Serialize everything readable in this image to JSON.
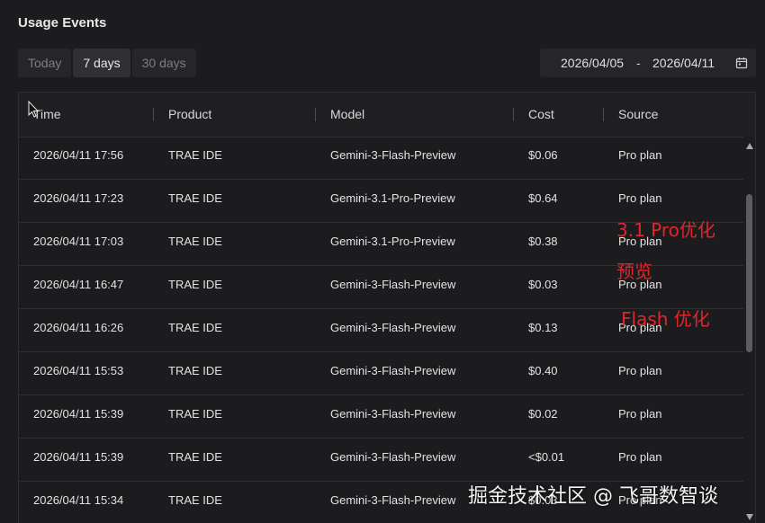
{
  "panel": {
    "title": "Usage Events"
  },
  "range_tabs": [
    {
      "label": "Today",
      "active": false
    },
    {
      "label": "7 days",
      "active": true
    },
    {
      "label": "30 days",
      "active": false
    }
  ],
  "date_range": {
    "start": "2026/04/05",
    "separator": "-",
    "end": "2026/04/11",
    "icon": "calendar-icon"
  },
  "table": {
    "columns": [
      "Time",
      "Product",
      "Model",
      "Cost",
      "Source"
    ],
    "rows": [
      [
        "2026/04/11 17:56",
        "TRAE IDE",
        "Gemini-3-Flash-Preview",
        "$0.06",
        "Pro plan"
      ],
      [
        "2026/04/11 17:23",
        "TRAE IDE",
        "Gemini-3.1-Pro-Preview",
        "$0.64",
        "Pro plan"
      ],
      [
        "2026/04/11 17:03",
        "TRAE IDE",
        "Gemini-3.1-Pro-Preview",
        "$0.38",
        "Pro plan"
      ],
      [
        "2026/04/11 16:47",
        "TRAE IDE",
        "Gemini-3-Flash-Preview",
        "$0.03",
        "Pro plan"
      ],
      [
        "2026/04/11 16:26",
        "TRAE IDE",
        "Gemini-3-Flash-Preview",
        "$0.13",
        "Pro plan"
      ],
      [
        "2026/04/11 15:53",
        "TRAE IDE",
        "Gemini-3-Flash-Preview",
        "$0.40",
        "Pro plan"
      ],
      [
        "2026/04/11 15:39",
        "TRAE IDE",
        "Gemini-3-Flash-Preview",
        "$0.02",
        "Pro plan"
      ],
      [
        "2026/04/11 15:39",
        "TRAE IDE",
        "Gemini-3-Flash-Preview",
        "<$0.01",
        "Pro plan"
      ],
      [
        "2026/04/11 15:34",
        "TRAE IDE",
        "Gemini-3-Flash-Preview",
        "$0.03",
        "Pro plan"
      ]
    ]
  },
  "annotations": {
    "line1": "3.1 Pro优化",
    "line2": "预览",
    "line3": "Flash 优化"
  },
  "watermark": "掘金技术社区 @ 飞哥数智谈",
  "colors": {
    "background": "#1c1c1f",
    "annotation": "#e0262b"
  }
}
